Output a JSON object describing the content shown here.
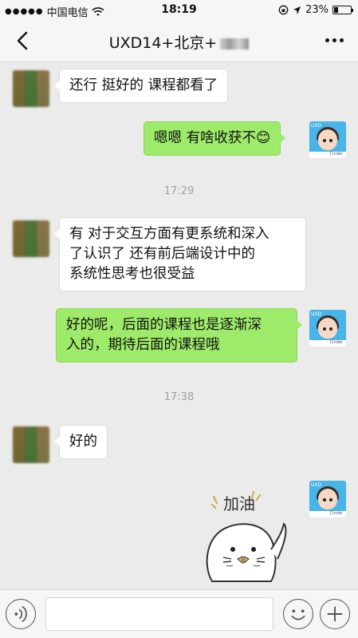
{
  "status_bar": {
    "carrier": "中国电信",
    "time": "18:19",
    "battery": "23%",
    "battery_level": 0.23
  },
  "header": {
    "title": "UXD14+北京+"
  },
  "messages": [
    {
      "side": "in",
      "text": "还行 挺好的 课程都看了"
    },
    {
      "side": "out",
      "text": "嗯嗯 有啥收获不😊"
    },
    {
      "side": "time",
      "text": "17:29"
    },
    {
      "side": "in",
      "lines": [
        "有  对于交互方面有更系统和深入",
        "了认识了   还有前后端设计中的",
        "系统性思考也很受益"
      ]
    },
    {
      "side": "out",
      "lines": [
        "好的呢，后面的课程也是逐渐深",
        "入的，期待后面的课程哦"
      ]
    },
    {
      "side": "time",
      "text": "17:38"
    },
    {
      "side": "in",
      "text": "好的"
    },
    {
      "side": "sticker",
      "text": "加油"
    }
  ],
  "icons": {
    "back": "chevron-left-icon",
    "more": "more-dots-icon",
    "voice": "voice-icon",
    "emoji": "emoji-icon",
    "plus": "plus-icon"
  },
  "colors": {
    "out_bubble": "#9eea6a",
    "in_bubble": "#ffffff",
    "background": "#ebebeb"
  }
}
